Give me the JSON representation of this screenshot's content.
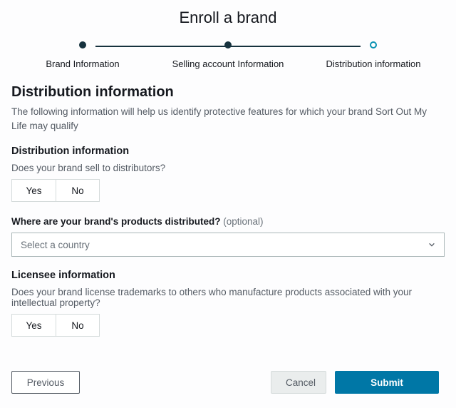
{
  "title": "Enroll a brand",
  "stepper": {
    "steps": [
      {
        "label": "Brand Information",
        "state": "done"
      },
      {
        "label": "Selling account Information",
        "state": "done"
      },
      {
        "label": "Distribution information",
        "state": "current"
      }
    ]
  },
  "heading": "Distribution information",
  "description": "The following information will help us identify protective features for which your brand Sort Out My Life may qualify",
  "distribution": {
    "section_label": "Distribution information",
    "distributors_question": "Does your brand sell to distributors?",
    "yes_label": "Yes",
    "no_label": "No",
    "country_label": "Where are your brand's products distributed?",
    "country_optional": "(optional)",
    "country_placeholder": "Select a country"
  },
  "licensee": {
    "section_label": "Licensee information",
    "question": "Does your brand license trademarks to others who manufacture products associated with your intellectual property?",
    "yes_label": "Yes",
    "no_label": "No"
  },
  "footer": {
    "previous": "Previous",
    "cancel": "Cancel",
    "submit": "Submit"
  }
}
